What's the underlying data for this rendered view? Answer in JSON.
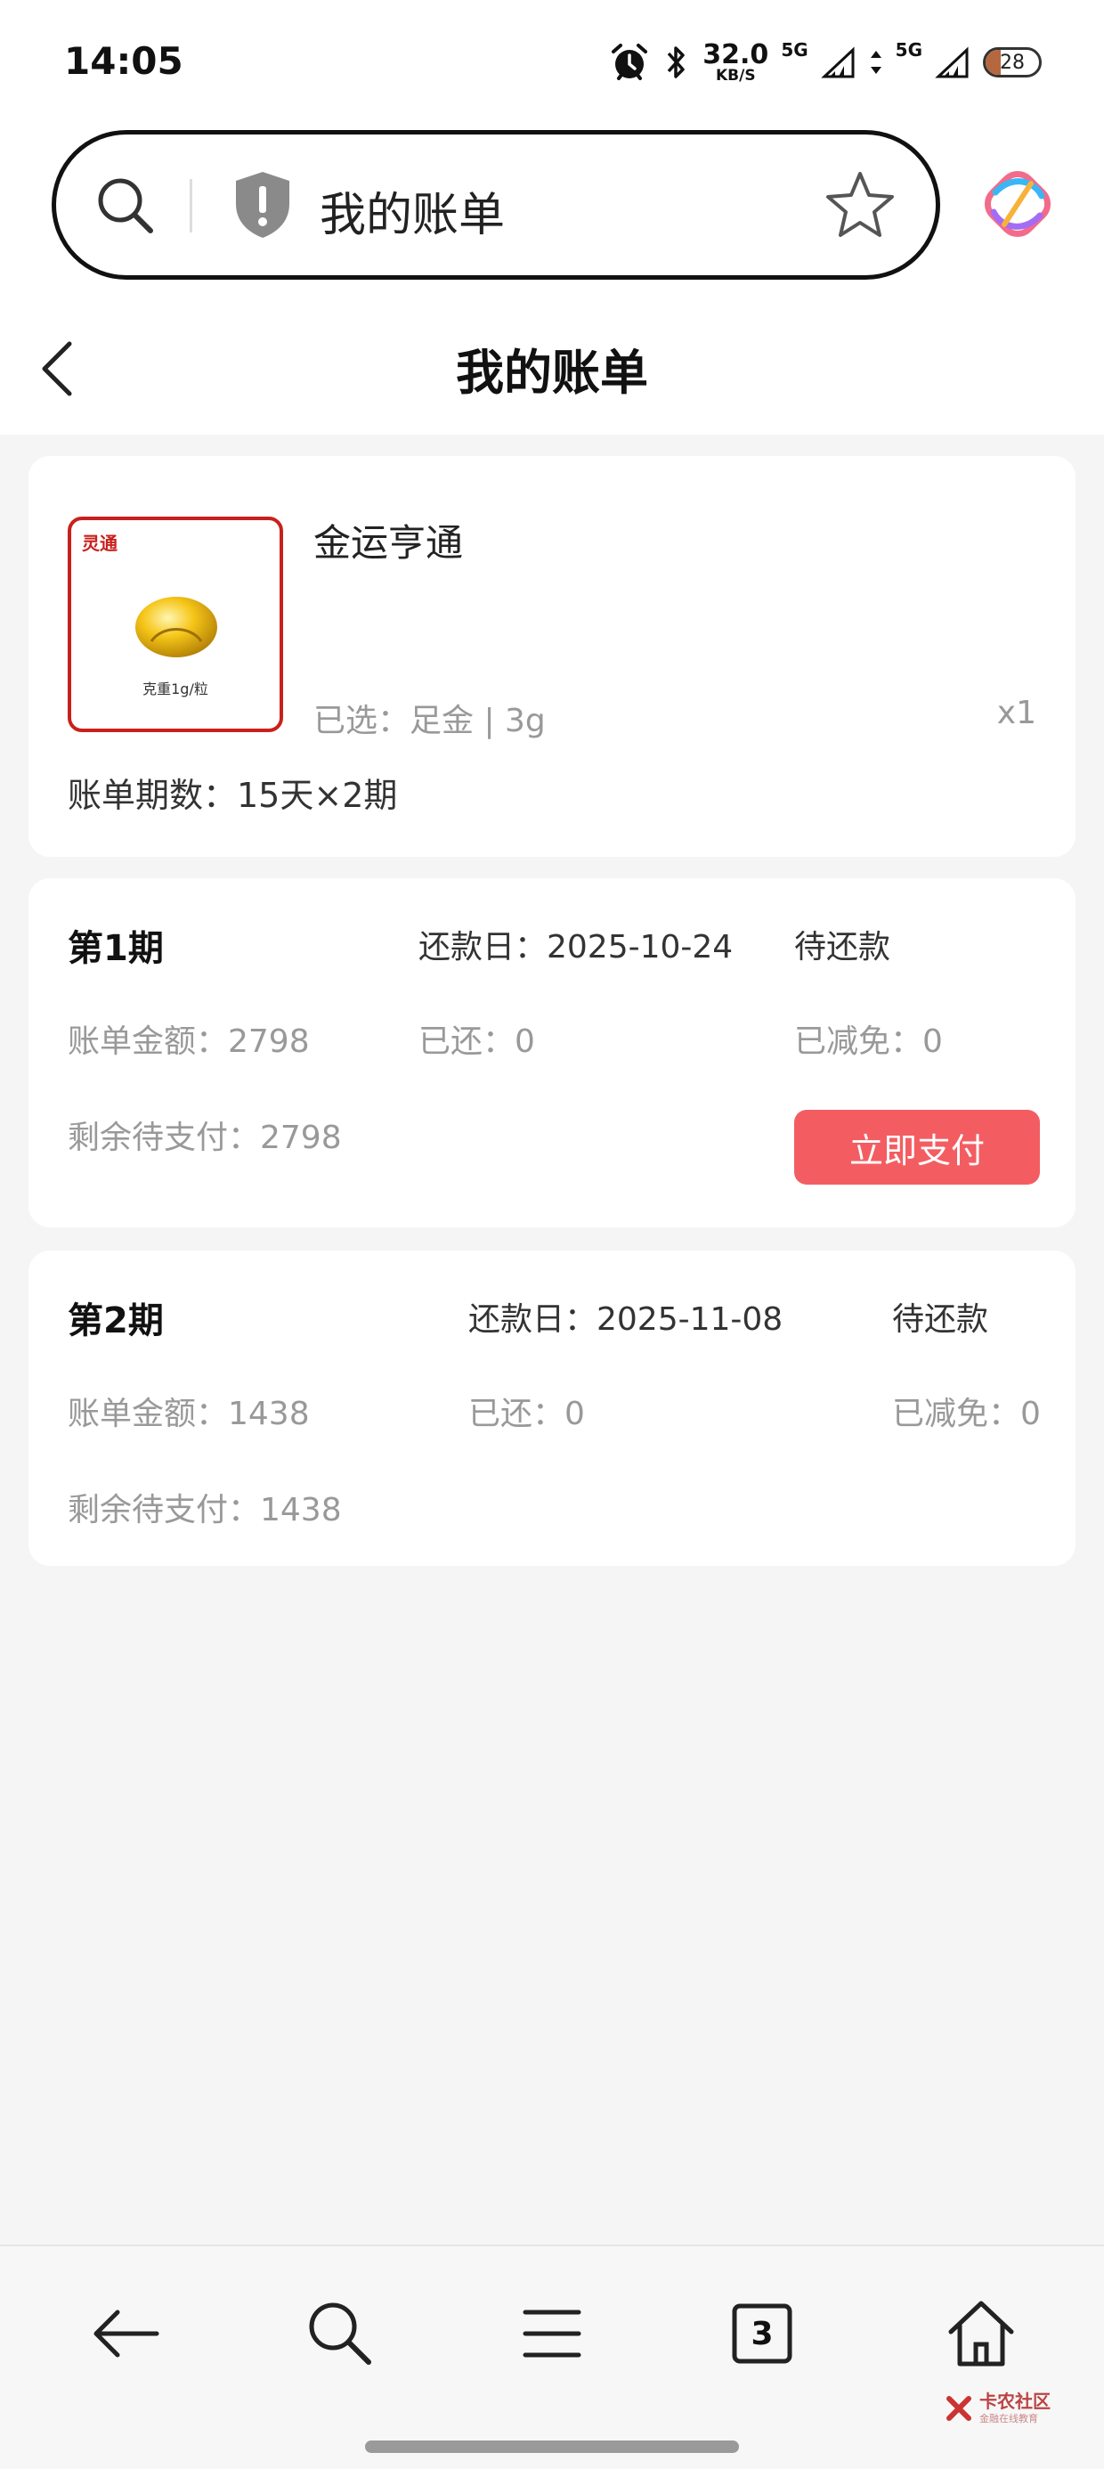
{
  "status_bar": {
    "time": "14:05",
    "net_speed": "32.0",
    "net_unit": "KB/S",
    "signal1_label": "5G",
    "signal2_label": "5G",
    "battery": "28"
  },
  "search": {
    "query": "我的账单"
  },
  "header": {
    "title": "我的账单"
  },
  "product": {
    "thumb_brand": "灵通",
    "thumb_spec": "克重1g/粒",
    "name": "金运亨通",
    "selected": "已选：足金 | 3g",
    "quantity": "x1",
    "bill_periods": "账单期数：15天×2期"
  },
  "periods": [
    {
      "title": "第1期",
      "due_date": "还款日：2025-10-24",
      "status": "待还款",
      "amount": "账单金额：2798",
      "paid": "已还：0",
      "waived": "已减免：0",
      "remaining": "剩余待支付：2798",
      "pay_label": "立即支付"
    },
    {
      "title": "第2期",
      "due_date": "还款日：2025-11-08",
      "status": "待还款",
      "amount": "账单金额：1438",
      "paid": "已还：0",
      "waived": "已减免：0",
      "remaining": "剩余待支付：1438"
    }
  ],
  "bottom_nav": {
    "tab_count": "3",
    "watermark": "卡农社区",
    "watermark_sub": "金融在线教育"
  },
  "colors": {
    "accent": "#f35d62",
    "thumb_border": "#c9201c",
    "page_bg": "#f5f5f5"
  },
  "icons": [
    "alarm-icon",
    "bluetooth-icon",
    "search-icon",
    "shield-icon",
    "star-icon",
    "app-logo-icon",
    "back-chevron-icon",
    "gold-bean-image",
    "back-arrow-icon",
    "menu-icon",
    "tabs-icon",
    "home-icon"
  ]
}
